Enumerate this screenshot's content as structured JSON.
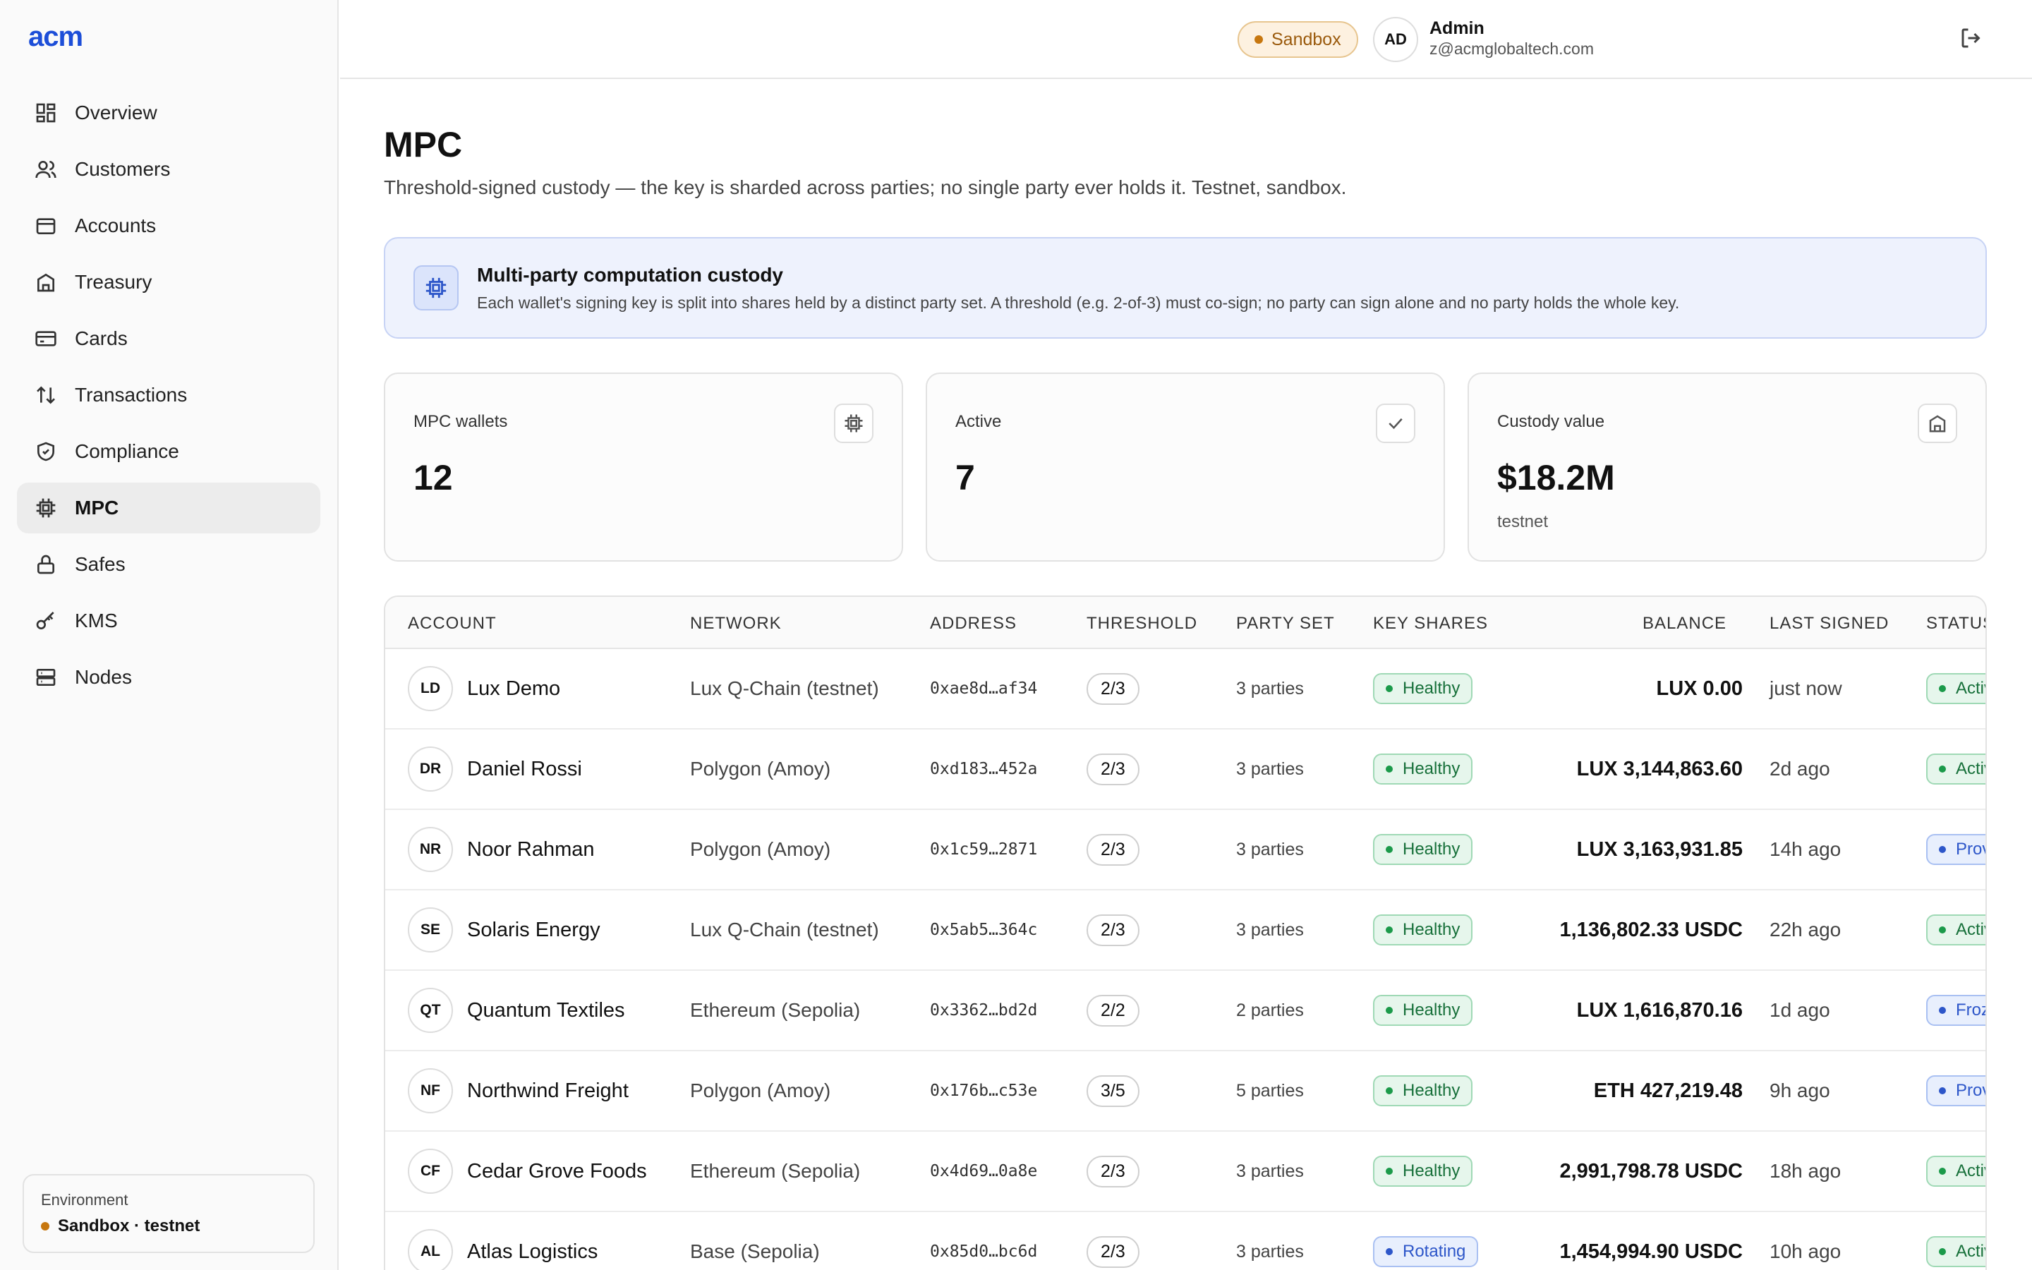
{
  "app": {
    "logo": "acm"
  },
  "sidebar": {
    "items": [
      {
        "label": "Overview",
        "icon": "overview-icon"
      },
      {
        "label": "Customers",
        "icon": "users-icon"
      },
      {
        "label": "Accounts",
        "icon": "wallet-icon"
      },
      {
        "label": "Treasury",
        "icon": "bank-icon"
      },
      {
        "label": "Cards",
        "icon": "card-icon"
      },
      {
        "label": "Transactions",
        "icon": "arrows-icon"
      },
      {
        "label": "Compliance",
        "icon": "shield-icon"
      },
      {
        "label": "MPC",
        "icon": "chip-icon",
        "active": true
      },
      {
        "label": "Safes",
        "icon": "lock-icon"
      },
      {
        "label": "KMS",
        "icon": "key-icon"
      },
      {
        "label": "Nodes",
        "icon": "server-icon"
      }
    ],
    "environment": {
      "label": "Environment",
      "value": "Sandbox · testnet"
    }
  },
  "header": {
    "env_badge": "Sandbox",
    "avatar": "AD",
    "user_name": "Admin",
    "user_email": "z@acmglobaltech.com"
  },
  "page": {
    "title": "MPC",
    "subtitle": "Threshold-signed custody — the key is sharded across parties; no single party ever holds it. Testnet, sandbox."
  },
  "banner": {
    "title": "Multi-party computation custody",
    "text": "Each wallet's signing key is split into shares held by a distinct party set. A threshold (e.g. 2-of-3) must co-sign; no party can sign alone and no party holds the whole key."
  },
  "stats": [
    {
      "label": "MPC wallets",
      "value": "12",
      "note": ""
    },
    {
      "label": "Active",
      "value": "7",
      "note": ""
    },
    {
      "label": "Custody value",
      "value": "$18.2M",
      "note": "testnet"
    }
  ],
  "table": {
    "columns": [
      "ACCOUNT",
      "NETWORK",
      "ADDRESS",
      "THRESHOLD",
      "PARTY SET",
      "KEY SHARES",
      "BALANCE",
      "LAST SIGNED",
      "STATUS"
    ],
    "rows": [
      {
        "initials": "LD",
        "account": "Lux Demo",
        "network": "Lux Q-Chain (testnet)",
        "address": "0xae8d…af34",
        "threshold": "2/3",
        "party": "3 parties",
        "shares": "Healthy",
        "balance": "LUX 0.00",
        "last": "just now",
        "status": "Active",
        "status_color": "green"
      },
      {
        "initials": "DR",
        "account": "Daniel Rossi",
        "network": "Polygon (Amoy)",
        "address": "0xd183…452a",
        "threshold": "2/3",
        "party": "3 parties",
        "shares": "Healthy",
        "balance": "LUX 3,144,863.60",
        "last": "2d ago",
        "status": "Active",
        "status_color": "green"
      },
      {
        "initials": "NR",
        "account": "Noor Rahman",
        "network": "Polygon (Amoy)",
        "address": "0x1c59…2871",
        "threshold": "2/3",
        "party": "3 parties",
        "shares": "Healthy",
        "balance": "LUX 3,163,931.85",
        "last": "14h ago",
        "status": "Provisioning",
        "status_color": "blue"
      },
      {
        "initials": "SE",
        "account": "Solaris Energy",
        "network": "Lux Q-Chain (testnet)",
        "address": "0x5ab5…364c",
        "threshold": "2/3",
        "party": "3 parties",
        "shares": "Healthy",
        "balance": "1,136,802.33 USDC",
        "last": "22h ago",
        "status": "Active",
        "status_color": "green"
      },
      {
        "initials": "QT",
        "account": "Quantum Textiles",
        "network": "Ethereum (Sepolia)",
        "address": "0x3362…bd2d",
        "threshold": "2/2",
        "party": "2 parties",
        "shares": "Healthy",
        "balance": "LUX 1,616,870.16",
        "last": "1d ago",
        "status": "Frozen",
        "status_color": "blue"
      },
      {
        "initials": "NF",
        "account": "Northwind Freight",
        "network": "Polygon (Amoy)",
        "address": "0x176b…c53e",
        "threshold": "3/5",
        "party": "5 parties",
        "shares": "Healthy",
        "balance": "ETH 427,219.48",
        "last": "9h ago",
        "status": "Provisioning",
        "status_color": "blue"
      },
      {
        "initials": "CF",
        "account": "Cedar Grove Foods",
        "network": "Ethereum (Sepolia)",
        "address": "0x4d69…0a8e",
        "threshold": "2/3",
        "party": "3 parties",
        "shares": "Healthy",
        "balance": "2,991,798.78 USDC",
        "last": "18h ago",
        "status": "Active",
        "status_color": "green"
      },
      {
        "initials": "AL",
        "account": "Atlas Logistics",
        "network": "Base (Sepolia)",
        "address": "0x85d0…bc6d",
        "threshold": "2/3",
        "party": "3 parties",
        "shares": "Rotating",
        "balance": "1,454,994.90 USDC",
        "last": "10h ago",
        "status": "Active",
        "status_color": "green"
      }
    ]
  },
  "colors": {
    "accent": "#1d4ed8",
    "healthy": "#1b9a4a",
    "rotating": "#2d56c9",
    "sandbox": "#c7770f"
  }
}
